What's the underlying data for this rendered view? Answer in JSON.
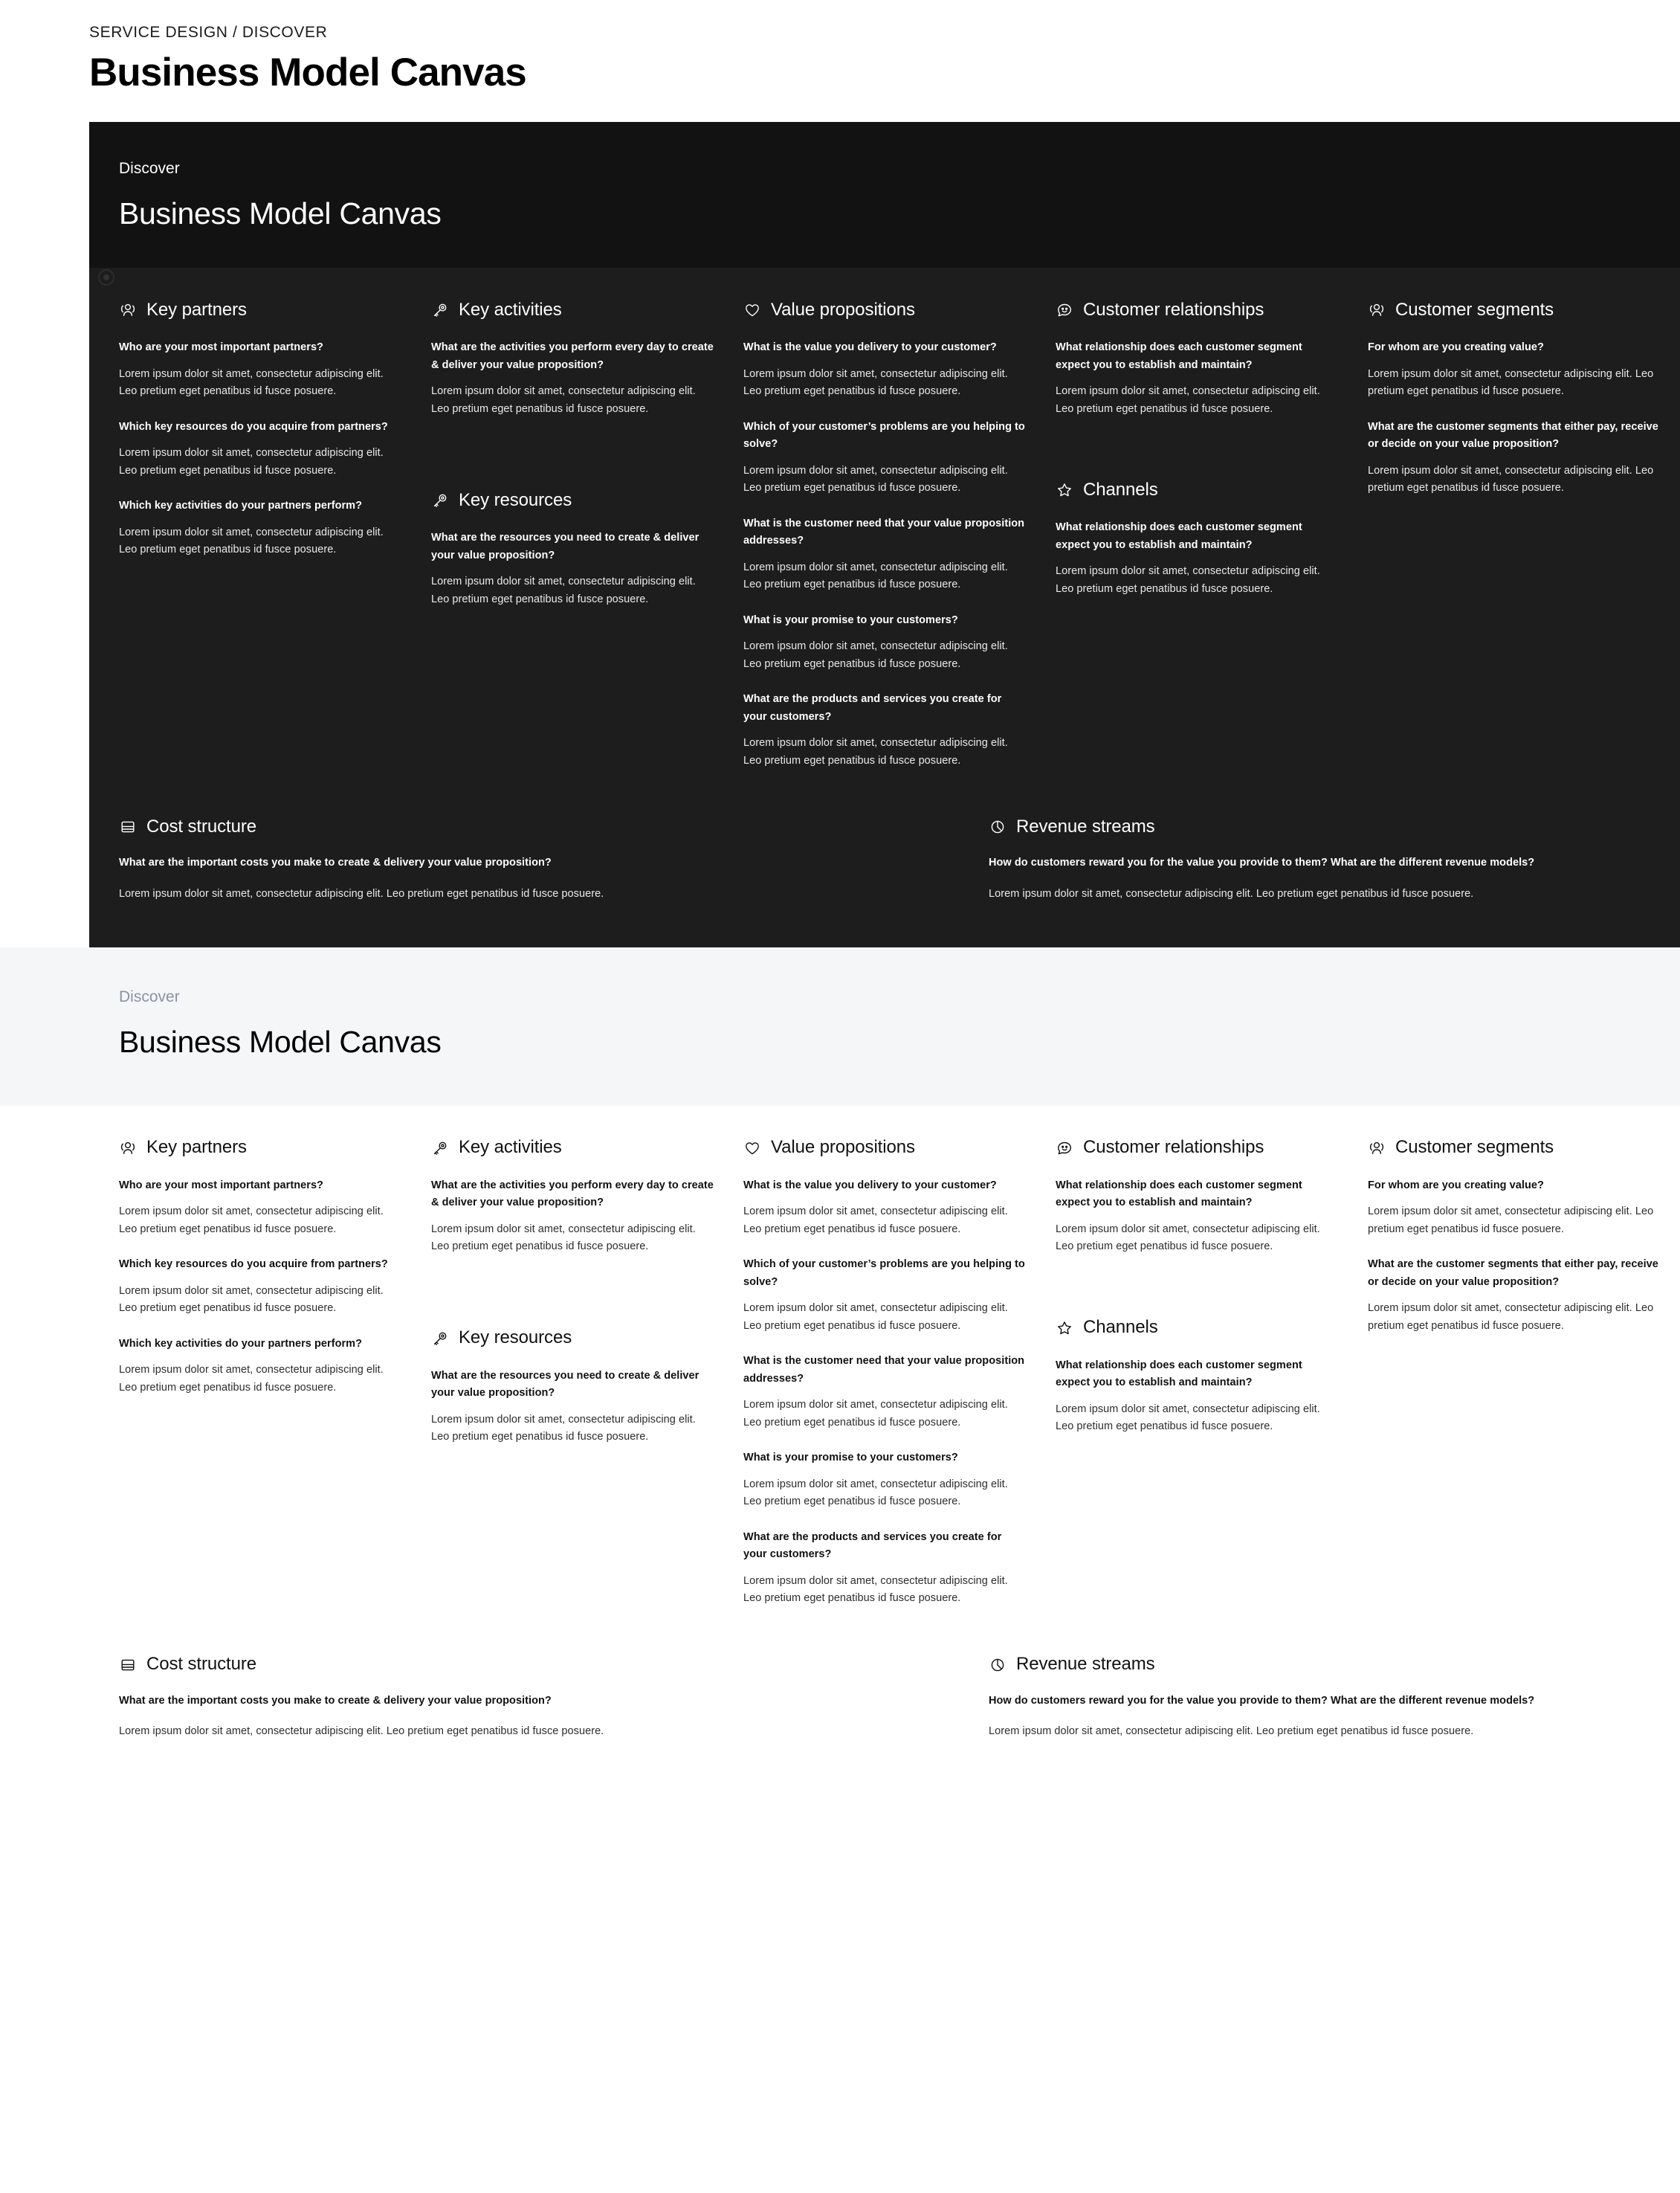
{
  "page": {
    "eyebrow": "SERVICE DESIGN / DISCOVER",
    "title": "Business Model Canvas"
  },
  "lorem": "Lorem ipsum dolor sit amet, consectetur adipiscing elit. Leo pretium eget penatibus id fusce posuere.",
  "lorem_wide": "Lorem ipsum dolor sit amet, consectetur adipiscing elit. Leo pretium eget penatibus id fusce posuere.",
  "canvas": {
    "eyebrow": "Discover",
    "title": "Business Model Canvas",
    "sections": {
      "key_partners": {
        "icon": "people-icon",
        "label": "Key partners",
        "blocks": [
          {
            "q": "Who are your most important partners?",
            "a": "Lorem ipsum dolor sit amet, consectetur adipiscing elit. Leo pretium eget penatibus id fusce posuere."
          },
          {
            "q": "Which key resources do you acquire from partners?",
            "a": "Lorem ipsum dolor sit amet, consectetur adipiscing elit. Leo pretium eget penatibus id fusce posuere."
          },
          {
            "q": "Which key activities do your partners perform?",
            "a": "Lorem ipsum dolor sit amet, consectetur adipiscing elit. Leo pretium eget penatibus id fusce posuere."
          }
        ]
      },
      "key_activities": {
        "icon": "key-icon",
        "label": "Key activities",
        "blocks": [
          {
            "q": "What are the activities you perform every day to create & deliver your value proposition?",
            "a": "Lorem ipsum dolor sit amet, consectetur adipiscing elit. Leo pretium eget penatibus id fusce posuere."
          }
        ]
      },
      "key_resources": {
        "icon": "key-icon",
        "label": "Key resources",
        "blocks": [
          {
            "q": "What are the resources you need to create & deliver your value proposition?",
            "a": "Lorem ipsum dolor sit amet, consectetur adipiscing elit. Leo pretium eget penatibus id fusce posuere."
          }
        ]
      },
      "value_propositions": {
        "icon": "heart-icon",
        "label": "Value propositions",
        "blocks": [
          {
            "q": "What is the value you delivery to your customer?",
            "a": "Lorem ipsum dolor sit amet, consectetur adipiscing elit. Leo pretium eget penatibus id fusce posuere."
          },
          {
            "q": "Which of your customer’s problems are you helping to solve?",
            "a": "Lorem ipsum dolor sit amet, consectetur adipiscing elit. Leo pretium eget penatibus id fusce posuere."
          },
          {
            "q": "What is the customer need that your value proposition addresses?",
            "a": "Lorem ipsum dolor sit amet, consectetur adipiscing elit. Leo pretium eget penatibus id fusce posuere."
          },
          {
            "q": "What is your promise to your customers?",
            "a": "Lorem ipsum dolor sit amet, consectetur adipiscing elit. Leo pretium eget penatibus id fusce posuere."
          },
          {
            "q": "What are the products and services you create for your customers?",
            "a": "Lorem ipsum dolor sit amet, consectetur adipiscing elit. Leo pretium eget penatibus id fusce posuere."
          }
        ]
      },
      "customer_relationships": {
        "icon": "chat-smile-icon",
        "label": "Customer relationships",
        "blocks": [
          {
            "q": "What relationship does each customer segment expect you to establish and maintain?",
            "a": "Lorem ipsum dolor sit amet, consectetur adipiscing elit. Leo pretium eget penatibus id fusce posuere."
          }
        ]
      },
      "channels": {
        "icon": "star-icon",
        "label": "Channels",
        "blocks": [
          {
            "q": "What relationship does each customer segment expect you to establish and maintain?",
            "a": "Lorem ipsum dolor sit amet, consectetur adipiscing elit. Leo pretium eget penatibus id fusce posuere."
          }
        ]
      },
      "customer_segments": {
        "icon": "people-icon",
        "label": "Customer segments",
        "blocks": [
          {
            "q": "For whom are you creating value?",
            "a": "Lorem ipsum dolor sit amet, consectetur adipiscing elit. Leo pretium eget penatibus id fusce posuere."
          },
          {
            "q": "What are the customer segments that either pay, receive or decide on your value proposition?",
            "a": "Lorem ipsum dolor sit amet, consectetur adipiscing elit. Leo pretium eget penatibus id fusce posuere."
          }
        ]
      },
      "cost_structure": {
        "icon": "layout-panel-icon",
        "label": "Cost structure",
        "blocks": [
          {
            "q": "What are the important costs you make to create & delivery your value proposition?",
            "a": "Lorem ipsum dolor sit amet, consectetur adipiscing elit. Leo pretium eget penatibus id fusce posuere."
          }
        ]
      },
      "revenue_streams": {
        "icon": "pie-chart-icon",
        "label": "Revenue streams",
        "blocks": [
          {
            "q": "How do customers reward you for the value you provide to them? What are the different revenue models?",
            "a": "Lorem ipsum dolor sit amet, consectetur adipiscing elit. Leo pretium eget penatibus id fusce posuere."
          }
        ]
      }
    }
  },
  "colors": {
    "dark_panel": "#1d1d1d",
    "dark_header": "#121212",
    "light_header": "#f5f6f8",
    "light_eyebrow": "#8b93a1",
    "text_on_dark": "#ffffff",
    "text_on_light": "#111111"
  }
}
